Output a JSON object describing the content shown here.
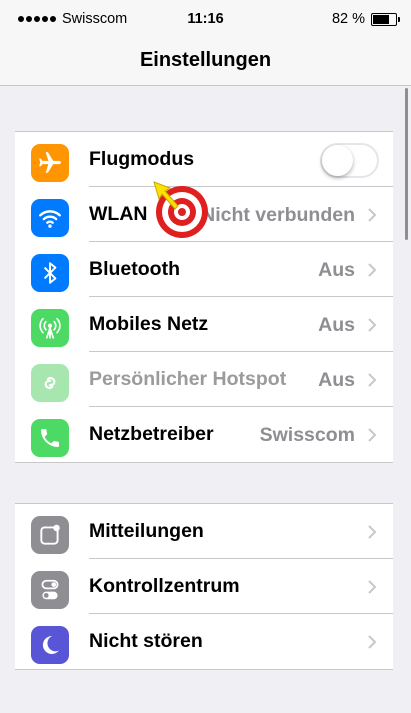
{
  "status_bar": {
    "carrier": "Swisscom",
    "time": "11:16",
    "battery": "82 %",
    "battery_level": 0.82
  },
  "nav": {
    "title": "Einstellungen"
  },
  "group1": [
    {
      "label": "Flugmodus",
      "icon": "airplane-icon",
      "color": "#ff9500",
      "toggle": false
    },
    {
      "label": "WLAN",
      "value": "Nicht verbunden",
      "icon": "wifi-icon",
      "color": "#007aff"
    },
    {
      "label": "Bluetooth",
      "value": "Aus",
      "icon": "bluetooth-icon",
      "color": "#007aff"
    },
    {
      "label": "Mobiles Netz",
      "value": "Aus",
      "icon": "antenna-icon",
      "color": "#4cd964"
    },
    {
      "label": "Persönlicher Hotspot",
      "value": "Aus",
      "icon": "hotspot-icon",
      "color": "#a8e6b0",
      "disabled": true
    },
    {
      "label": "Netzbetreiber",
      "value": "Swisscom",
      "icon": "phone-icon",
      "color": "#4cd964"
    }
  ],
  "group2": [
    {
      "label": "Mitteilungen",
      "icon": "notifications-icon",
      "color": "#8e8e93"
    },
    {
      "label": "Kontrollzentrum",
      "icon": "control-center-icon",
      "color": "#8e8e93"
    },
    {
      "label": "Nicht stören",
      "icon": "moon-icon",
      "color": "#5856d6"
    }
  ]
}
